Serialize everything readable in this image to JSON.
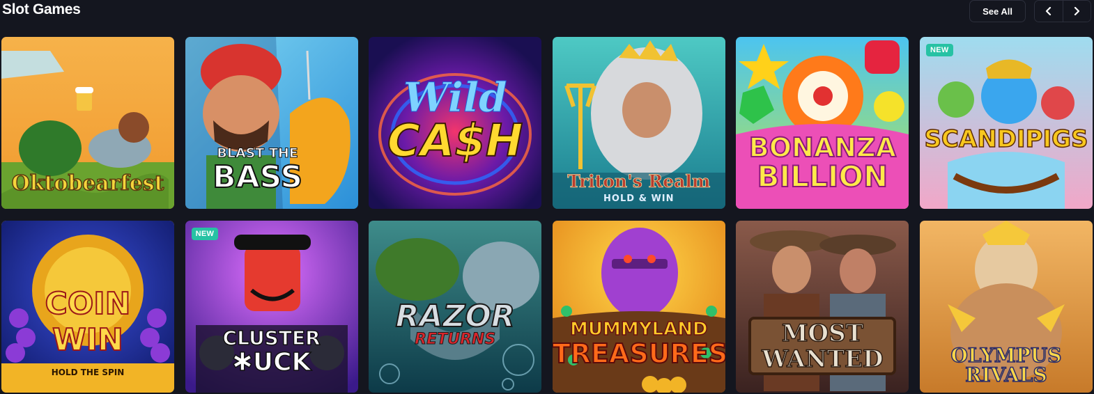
{
  "section": {
    "title": "Slot Games",
    "see_all_label": "See All"
  },
  "games": [
    {
      "logo": "Oktobearfest",
      "badge": ""
    },
    {
      "logo_line1": "BLAST THE",
      "logo_line2": "BASS",
      "badge": ""
    },
    {
      "logo_line1": "Wild",
      "logo_line2": "CA$H",
      "badge": ""
    },
    {
      "logo": "Triton's Realm",
      "sub": "HOLD & WIN",
      "badge": ""
    },
    {
      "logo_line1": "BONANZA",
      "logo_line2": "BILLION",
      "badge": ""
    },
    {
      "logo": "SCANDIPIGS",
      "badge": "NEW"
    },
    {
      "logo_line1": "COIN",
      "logo_line2": "WIN",
      "sub": "HOLD THE SPIN",
      "badge": ""
    },
    {
      "logo_line1": "CLUSTER",
      "logo_line2": "✱UCK",
      "badge": "NEW"
    },
    {
      "logo_line1": "RAZOR",
      "logo_line2": "RETURNS",
      "badge": ""
    },
    {
      "logo_line1": "MUMMYLAND",
      "logo_line2": "TREASURES",
      "badge": ""
    },
    {
      "logo_line1": "MOST",
      "logo_line2": "WANTED",
      "badge": ""
    },
    {
      "logo": "OLYMPUS RIVALS",
      "badge": ""
    }
  ]
}
